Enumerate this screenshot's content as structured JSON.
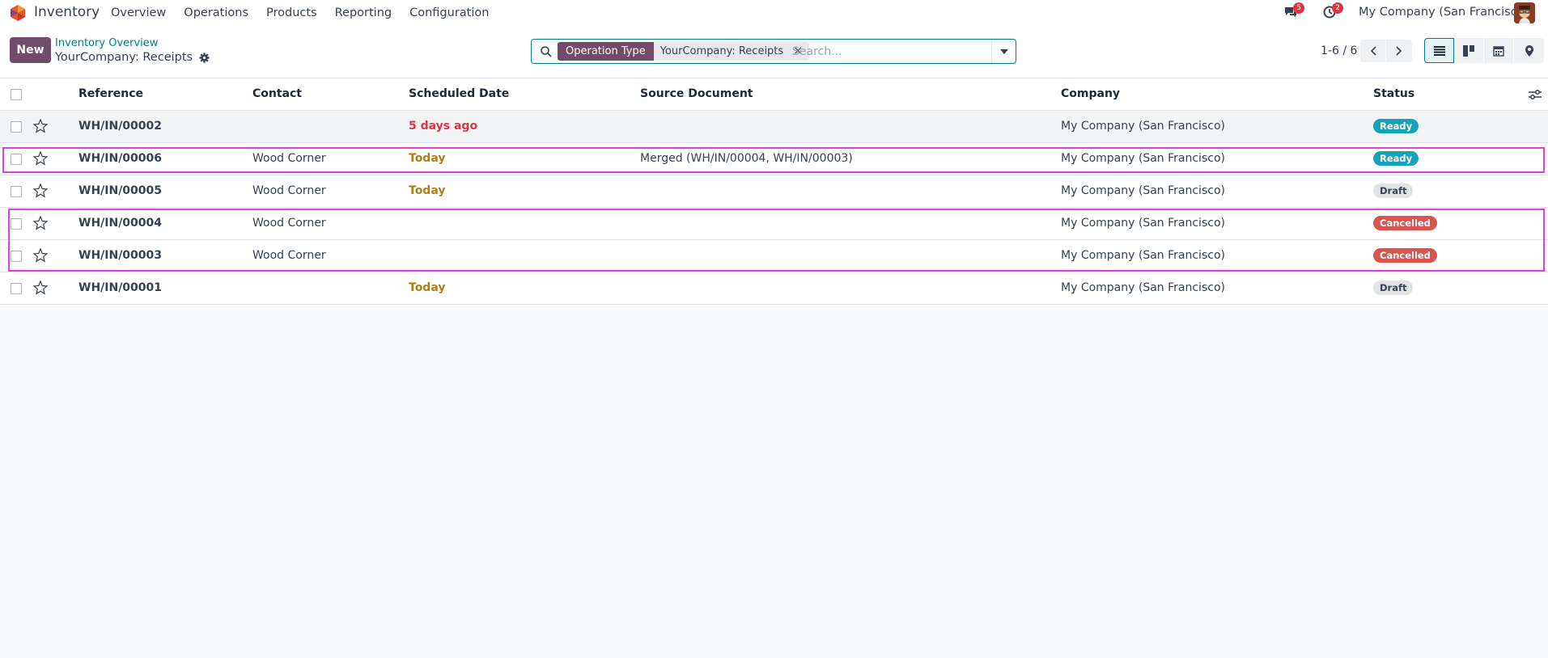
{
  "navbar": {
    "app_name": "Inventory",
    "menu": [
      "Overview",
      "Operations",
      "Products",
      "Reporting",
      "Configuration"
    ],
    "messages_badge": "5",
    "activities_badge": "2",
    "company": "My Company (San Francisco)"
  },
  "control": {
    "new_label": "New",
    "breadcrumb": "Inventory Overview",
    "title": "YourCompany: Receipts",
    "facet_type": "Operation Type",
    "facet_value": "YourCompany: Receipts",
    "facet_close": "×",
    "search_placeholder": "Search...",
    "pager": "1-6 / 6"
  },
  "table": {
    "headers": {
      "reference": "Reference",
      "contact": "Contact",
      "scheduled_date": "Scheduled Date",
      "source_document": "Source Document",
      "company": "Company",
      "status": "Status"
    },
    "rows": [
      {
        "reference": "WH/IN/00002",
        "contact": "",
        "date": "5 days ago",
        "source": "",
        "company": "My Company (San Francisco)",
        "status": "Ready"
      },
      {
        "reference": "WH/IN/00006",
        "contact": "Wood Corner",
        "date": "Today",
        "source": "Merged (WH/IN/00004, WH/IN/00003)",
        "company": "My Company (San Francisco)",
        "status": "Ready"
      },
      {
        "reference": "WH/IN/00005",
        "contact": "Wood Corner",
        "date": "Today",
        "source": "",
        "company": "My Company (San Francisco)",
        "status": "Draft"
      },
      {
        "reference": "WH/IN/00004",
        "contact": "Wood Corner",
        "date": "",
        "source": "",
        "company": "My Company (San Francisco)",
        "status": "Cancelled"
      },
      {
        "reference": "WH/IN/00003",
        "contact": "Wood Corner",
        "date": "",
        "source": "",
        "company": "My Company (San Francisco)",
        "status": "Cancelled"
      },
      {
        "reference": "WH/IN/00001",
        "contact": "",
        "date": "Today",
        "source": "",
        "company": "My Company (San Francisco)",
        "status": "Draft"
      }
    ]
  },
  "colors": {
    "brand": "#714b67",
    "accent": "#017e84",
    "highlight": "#e040e0"
  }
}
